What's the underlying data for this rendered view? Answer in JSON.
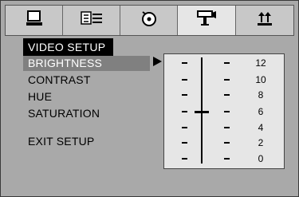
{
  "tabs": [
    {
      "name": "general-setup-tab",
      "icon": "monitor-icon"
    },
    {
      "name": "language-setup-tab",
      "icon": "language-icon"
    },
    {
      "name": "audio-setup-tab",
      "icon": "speaker-disc-icon"
    },
    {
      "name": "video-setup-tab",
      "icon": "video-camera-icon",
      "active": true
    },
    {
      "name": "preference-setup-tab",
      "icon": "sort-arrows-icon"
    }
  ],
  "menu": {
    "title": "VIDEO SETUP",
    "items": [
      "BRIGHTNESS",
      "CONTRAST",
      "HUE",
      "SATURATION",
      "EXIT SETUP"
    ],
    "selected_index": 0
  },
  "slider": {
    "levels": [
      "12",
      "10",
      "8",
      "6",
      "4",
      "2",
      "0"
    ],
    "current_value": 6
  },
  "colors": {
    "background": "#a9a9a9",
    "title_bg": "#000000",
    "selected_bg": "#808080",
    "panel_bg": "#e6e6e6"
  }
}
